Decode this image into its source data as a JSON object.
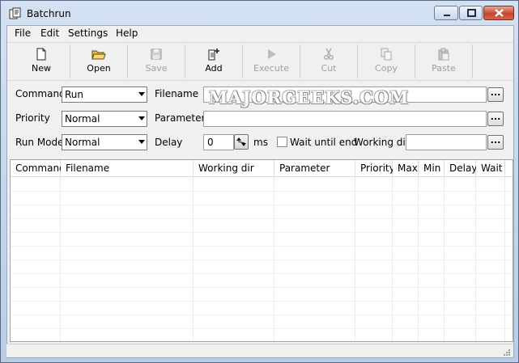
{
  "window": {
    "title": "Batchrun"
  },
  "menubar": {
    "items": [
      "File",
      "Edit",
      "Settings",
      "Help"
    ]
  },
  "toolbar": {
    "buttons": [
      {
        "label": "New",
        "icon": "new-document-icon",
        "enabled": true
      },
      {
        "label": "Open",
        "icon": "open-folder-icon",
        "enabled": true
      },
      {
        "label": "Save",
        "icon": "floppy-disk-icon",
        "enabled": false
      },
      {
        "label": "Add",
        "icon": "add-document-icon",
        "enabled": true
      },
      {
        "label": "Execute",
        "icon": "play-icon",
        "enabled": false
      },
      {
        "label": "Cut",
        "icon": "scissors-icon",
        "enabled": false
      },
      {
        "label": "Copy",
        "icon": "copy-icon",
        "enabled": false
      },
      {
        "label": "Paste",
        "icon": "clipboard-icon",
        "enabled": false
      }
    ]
  },
  "form": {
    "command_label": "Command",
    "command_value": "Run",
    "priority_label": "Priority",
    "priority_value": "Normal",
    "runmode_label": "Run Mode",
    "runmode_value": "Normal",
    "filename_label": "Filename",
    "filename_value": "",
    "parameter_label": "Parameter",
    "parameter_value": "",
    "delay_label": "Delay",
    "delay_value": "0",
    "delay_unit": "ms",
    "wait_label": "Wait until end",
    "wait_checked": false,
    "workdir_label": "Working dir",
    "workdir_value": "",
    "browse_label": "..."
  },
  "table": {
    "columns": [
      "Command",
      "Filename",
      "Working dir",
      "Parameter",
      "Priority",
      "Max",
      "Min",
      "Delay",
      "Wait"
    ],
    "rows": []
  },
  "watermark": "MAJORGEEKS.COM"
}
